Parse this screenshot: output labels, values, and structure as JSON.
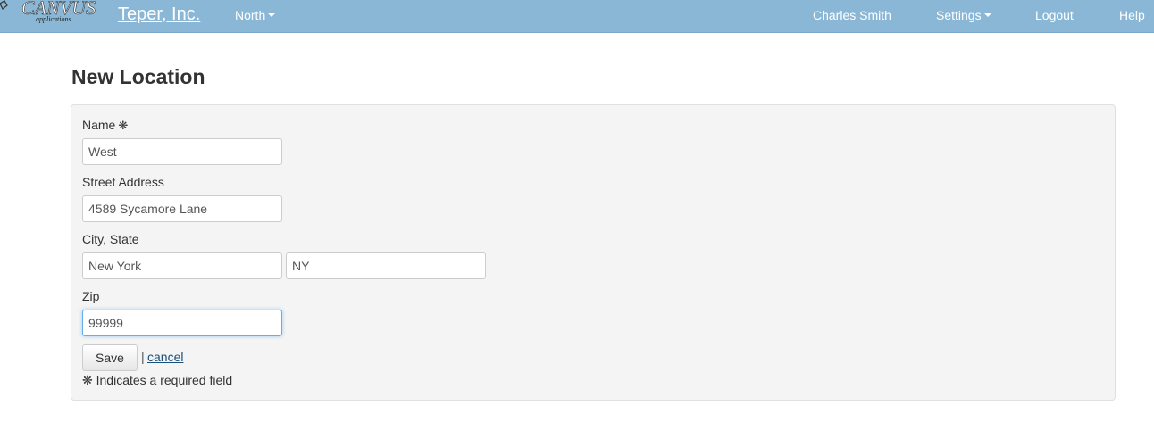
{
  "navbar": {
    "logo_text": "CANVUS",
    "logo_subtext": "applications",
    "brand": "Teper, Inc.",
    "region": "North",
    "user": "Charles Smith",
    "settings": "Settings",
    "logout": "Logout",
    "help": "Help",
    "color": "#8ab7d6"
  },
  "page": {
    "title": "New Location"
  },
  "form": {
    "name": {
      "label": "Name",
      "required_mark": "❋",
      "value": "West"
    },
    "street": {
      "label": "Street Address",
      "value": "4589 Sycamore Lane"
    },
    "city_state": {
      "label": "City, State",
      "city_value": "New York",
      "state_value": "NY"
    },
    "zip": {
      "label": "Zip",
      "value": "99999"
    },
    "save_label": "Save",
    "separator": "|",
    "cancel_label": "cancel",
    "required_note_mark": "❋",
    "required_note": "Indicates a required field"
  }
}
